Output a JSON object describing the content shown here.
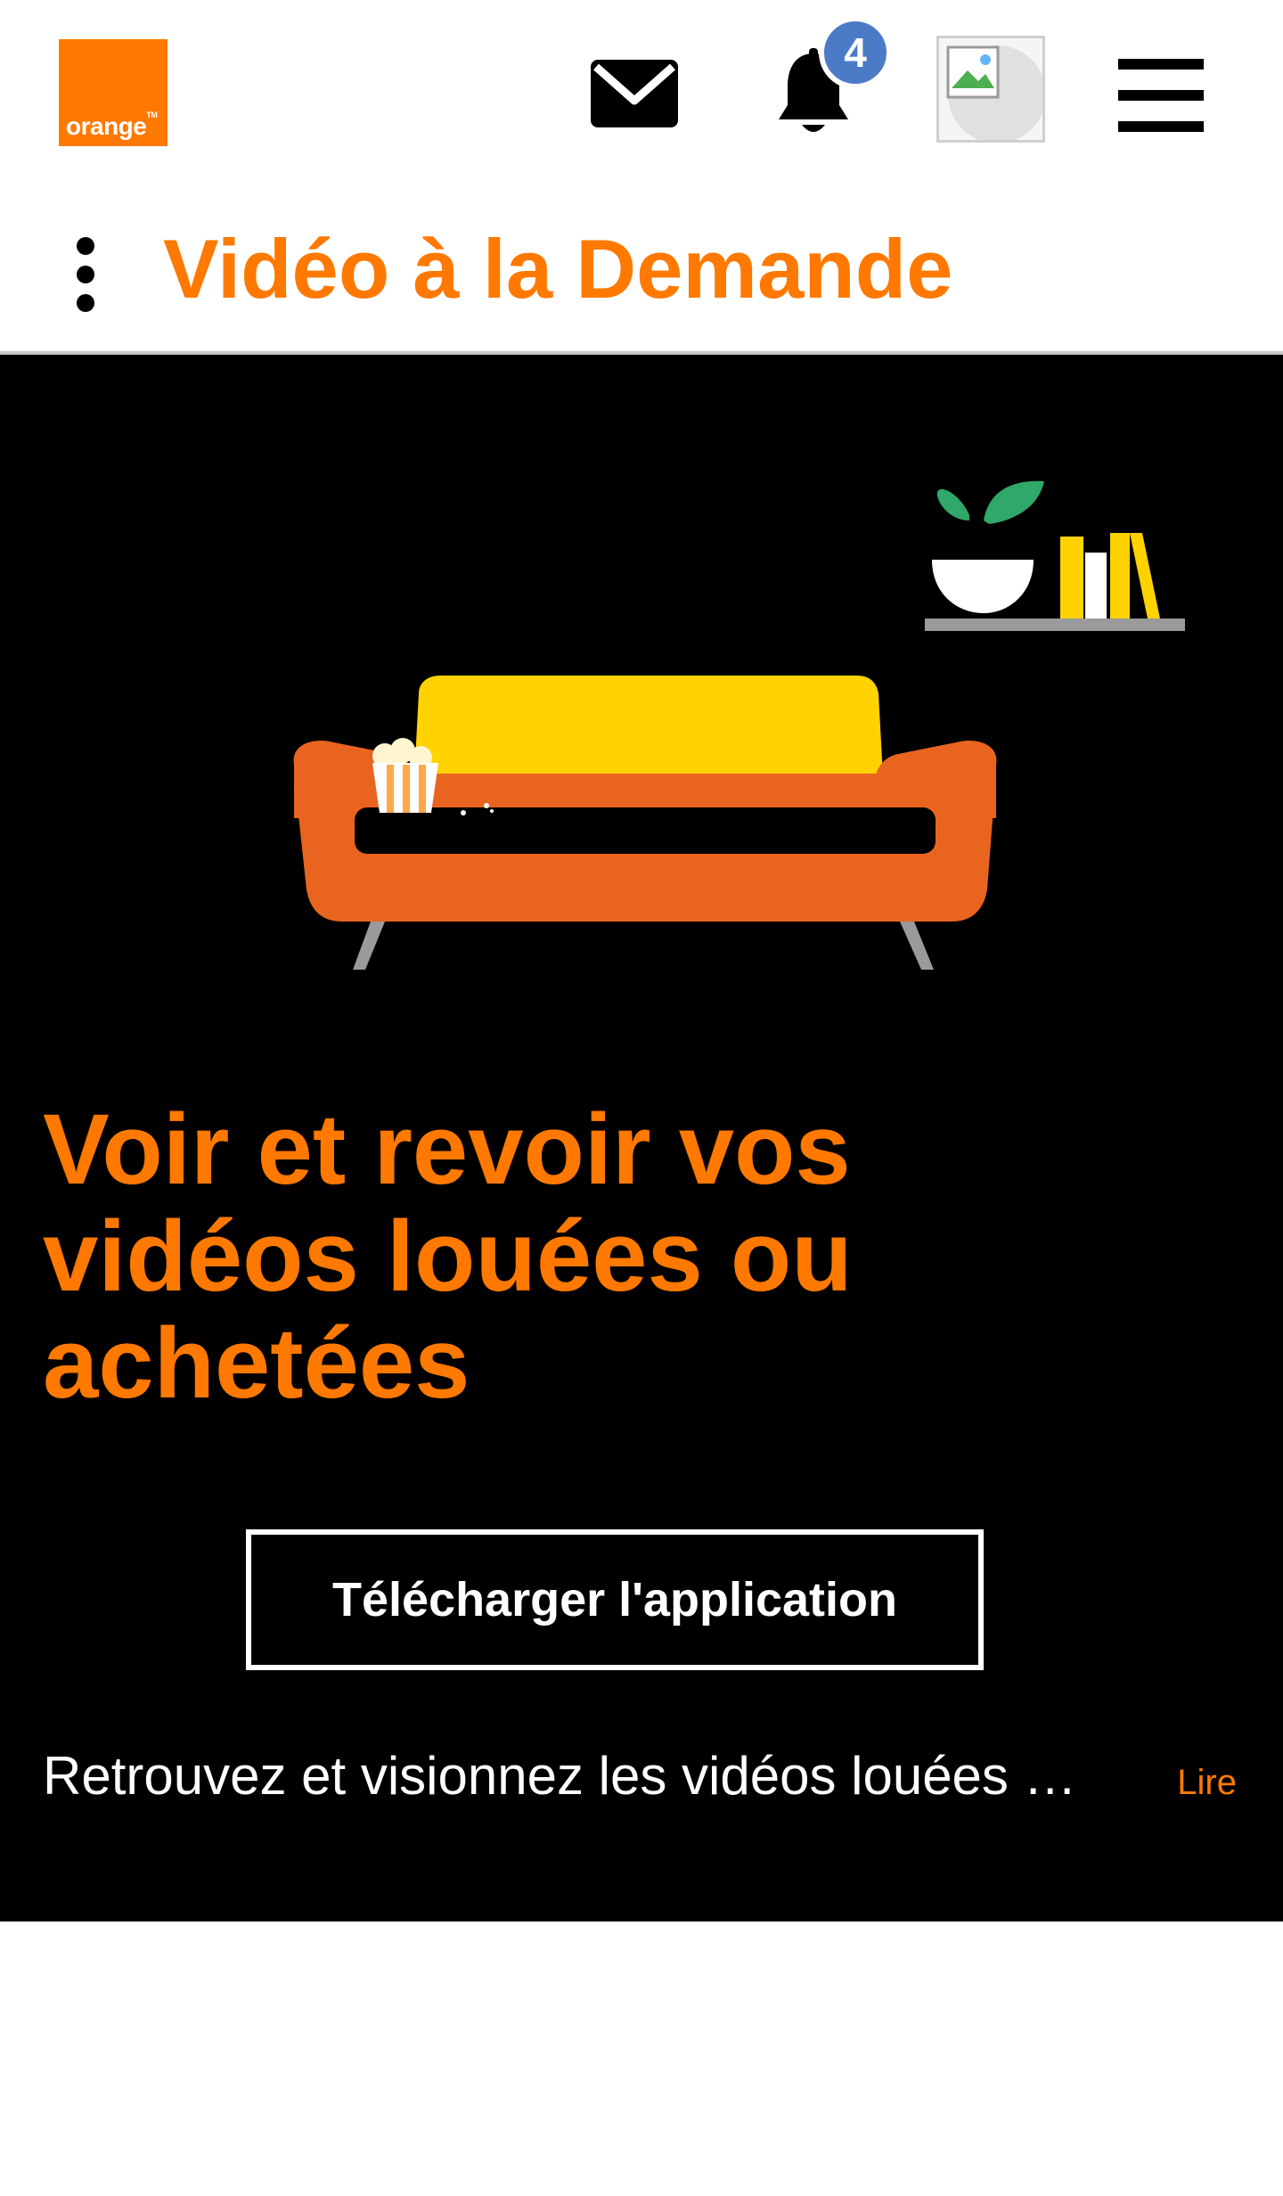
{
  "header": {
    "logo_text": "orange",
    "logo_tm": "TM",
    "notifications_count": "4"
  },
  "subheader": {
    "title": "Vidéo à la Demande"
  },
  "hero": {
    "title": "Voir et revoir vos vidéos louées ou achetées",
    "cta_label": "Télécharger l'application",
    "description": "Retrouvez et visionnez les vidéos louées …",
    "read_more": "Lire"
  },
  "colors": {
    "brand_orange": "#ff7900",
    "badge_blue": "#4b7bc6",
    "sofa_orange": "#e9651f",
    "cushion_yellow": "#ffd200",
    "plant_green": "#2fa86a",
    "shelf_gray": "#9a9a9a"
  },
  "icons": {
    "mail": "mail-icon",
    "bell": "bell-icon",
    "menu": "hamburger-menu-icon",
    "more": "kebab-menu-icon",
    "avatar": "broken-image-icon"
  }
}
